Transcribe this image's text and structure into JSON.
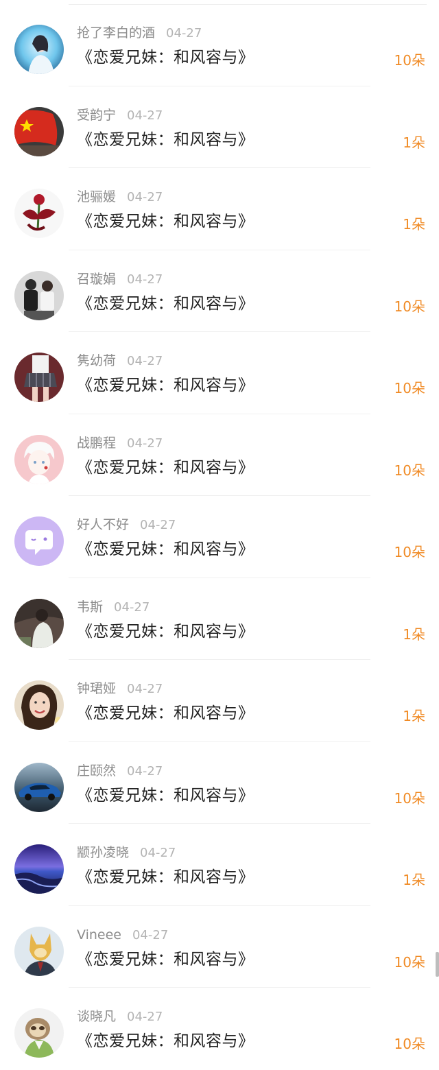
{
  "items": [
    {
      "user": "抢了李白的酒",
      "date": "04-27",
      "title": "《恋爱兄妹：和风容与》",
      "gift": "10朵",
      "avatar": "avatar-girl-blue-glow-icon"
    },
    {
      "user": "受韵宁",
      "date": "04-27",
      "title": "《恋爱兄妹：和风容与》",
      "gift": "1朵",
      "avatar": "avatar-red-flag-icon"
    },
    {
      "user": "池骊媛",
      "date": "04-27",
      "title": "《恋爱兄妹：和风容与》",
      "gift": "1朵",
      "avatar": "avatar-dragon-rose-icon"
    },
    {
      "user": "召璇娟",
      "date": "04-27",
      "title": "《恋爱兄妹：和风容与》",
      "gift": "10朵",
      "avatar": "avatar-couple-icon"
    },
    {
      "user": "隽幼荷",
      "date": "04-27",
      "title": "《恋爱兄妹：和风容与》",
      "gift": "10朵",
      "avatar": "avatar-girl-plaid-skirt-icon"
    },
    {
      "user": "战鹏程",
      "date": "04-27",
      "title": "《恋爱兄妹：和风容与》",
      "gift": "10朵",
      "avatar": "avatar-anime-boy-icon"
    },
    {
      "user": "好人不好",
      "date": "04-27",
      "title": "《恋爱兄妹：和风容与》",
      "gift": "10朵",
      "avatar": "avatar-purple-chat-icon"
    },
    {
      "user": "韦斯",
      "date": "04-27",
      "title": "《恋爱兄妹：和风容与》",
      "gift": "1朵",
      "avatar": "avatar-girl-dark-icon"
    },
    {
      "user": "钟珺娅",
      "date": "04-27",
      "title": "《恋爱兄妹：和风容与》",
      "gift": "1朵",
      "avatar": "avatar-smiling-woman-icon"
    },
    {
      "user": "庄颐然",
      "date": "04-27",
      "title": "《恋爱兄妹：和风容与》",
      "gift": "10朵",
      "avatar": "avatar-blue-car-icon"
    },
    {
      "user": "颛孙凌晓",
      "date": "04-27",
      "title": "《恋爱兄妹：和风容与》",
      "gift": "1朵",
      "avatar": "avatar-night-sea-icon"
    },
    {
      "user": "Vineee",
      "date": "04-27",
      "title": "《恋爱兄妹：和风容与》",
      "gift": "10朵",
      "avatar": "avatar-cartoon-fox-icon"
    },
    {
      "user": "谈晓凡",
      "date": "04-27",
      "title": "《恋爱兄妹：和风容与》",
      "gift": "10朵",
      "avatar": "avatar-sloth-icon"
    }
  ],
  "colors": {
    "gift": "#f08a24",
    "username": "#8c8c8c",
    "date": "#b4b4b4",
    "title": "#222222"
  }
}
